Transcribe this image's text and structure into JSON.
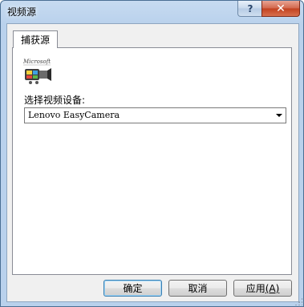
{
  "window": {
    "title": "视频源",
    "help_label": "?",
    "close_label": "✕"
  },
  "tabs": [
    {
      "label": "捕获源",
      "selected": true
    }
  ],
  "capture_source": {
    "logo_text": "Microsoft",
    "device_label": "选择视频设备:",
    "device_selected": "Lenovo EasyCamera"
  },
  "buttons": {
    "ok": "确定",
    "cancel": "取消",
    "apply_text": "应用",
    "apply_mnemonic": "(A)"
  },
  "colors": {
    "title_bar": "#b9d1ec",
    "close_button": "#c2411f",
    "panel_background": "#f0f0f0"
  }
}
